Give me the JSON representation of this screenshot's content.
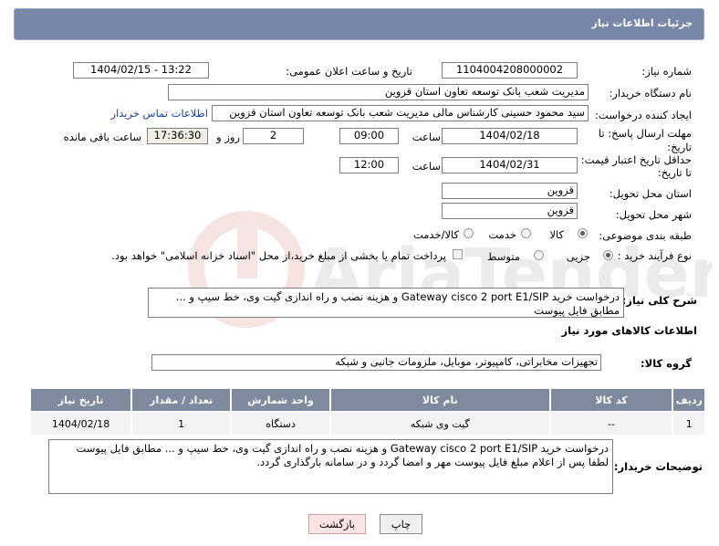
{
  "panel": {
    "title": "جزئیات اطلاعات نیاز"
  },
  "form": {
    "need_number_label": "شماره نیاز:",
    "need_number": "1104004208000002",
    "announce_datetime_label": "تاریخ و ساعت اعلان عمومی:",
    "announce_datetime": "1404/02/15 - 13:22",
    "buyer_org_label": "نام دستگاه خریدار:",
    "buyer_org": "مدیریت شعب بانک توسعه تعاون استان قزوین",
    "requester_label": "ایجاد کننده درخواست:",
    "requester": "سید محمود حسینی کارشناس مالی مدیریت شعب بانک توسعه تعاون استان قزوین",
    "contact_link": "اطلاعات تماس خریدار",
    "reply_deadline_label_1": "مهلت ارسال پاسخ: تا",
    "reply_deadline_label_2": "تاریخ:",
    "reply_date": "1404/02/18",
    "time_label": "ساعت",
    "reply_time": "09:00",
    "days_value": "2",
    "days_label": "روز و",
    "remaining_time": "17:36:30",
    "remaining_label": "ساعت باقی مانده",
    "price_validity_label_1": "حداقل تاریخ اعتبار قیمت:",
    "price_validity_label_2": "تا تاریخ:",
    "validity_date": "1404/02/31",
    "validity_time": "12:00",
    "delivery_province_label": "استان محل تحویل:",
    "delivery_province": "قزوین",
    "delivery_city_label": "شهر محل تحویل:",
    "delivery_city": "قزوین",
    "category_label": "طبقه بندی موضوعی:",
    "category_options": [
      "کالا",
      "خدمت",
      "کالا/خدمت"
    ],
    "category_selected": "کالا",
    "process_label": "نوع فرآیند خرید :",
    "process_options": [
      "جزیی",
      "متوسط"
    ],
    "process_selected": "جزیی",
    "payment_note": "پرداخت تمام یا بخشی از مبلغ خرید،از محل \"اسناد خزانه اسلامی\" خواهد بود."
  },
  "description": {
    "label": "شرح کلی نیاز:",
    "text": "درخواست خرید Gateway cisco 2 port E1/SIP و هزینه نصب و راه اندازی گیت وی، خط سیپ و ... مطابق فایل پیوست"
  },
  "goods": {
    "section_title": "اطلاعات کالاهای مورد نیاز",
    "group_label": "گروه کالا:",
    "group_value": "تجهیزات مخابراتی، کامپیوتر، موبایل، ملزومات جانبی و شبکه",
    "columns": [
      "ردیف",
      "کد کالا",
      "نام کالا",
      "واحد شمارش",
      "تعداد / مقدار",
      "تاریخ نیاز"
    ],
    "rows": [
      {
        "row": "1",
        "code": "--",
        "name": "گیت وی شبکه",
        "unit": "دستگاه",
        "qty": "1",
        "date": "1404/02/18"
      }
    ]
  },
  "buyer_notes": {
    "label": "توضیحات خریدار:",
    "line1": "درخواست خرید Gateway cisco 2 port E1/SIP و هزینه نصب و راه اندازی گیت وی، خط سیپ و ... مطابق فایل پیوست",
    "line2": "لطفا پس از اعلام مبلغ فایل پیوست مهر و امضا گردد و در سامانه بارگذاری گردد."
  },
  "buttons": {
    "print": "چاپ",
    "back": "بازگشت"
  },
  "watermark": {
    "text": "AriaTender.neT"
  }
}
